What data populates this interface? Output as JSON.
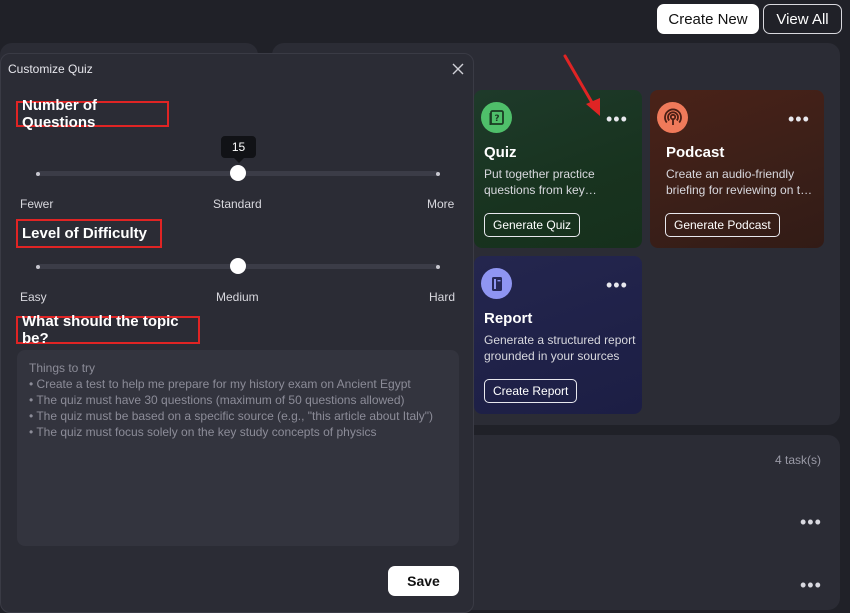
{
  "topbar": {
    "create_new": "Create New",
    "view_all": "View All"
  },
  "tasks": {
    "count_label": "4 task(s)"
  },
  "cards": [
    {
      "title": "Quiz",
      "desc": "Put together practice questions from key concepts",
      "button": "Generate Quiz",
      "icon": "quiz-icon",
      "accent": "#4fbf6a"
    },
    {
      "title": "Podcast",
      "desc": "Create an audio-friendly briefing for reviewing on the go",
      "button": "Generate Podcast",
      "icon": "podcast-icon",
      "accent": "#f07a5a"
    },
    {
      "title": "Report",
      "desc": "Generate a structured report grounded in your sources",
      "button": "Create Report",
      "icon": "report-icon",
      "accent": "#8f95f2"
    }
  ],
  "modal": {
    "title": "Customize Quiz",
    "num_questions": {
      "label": "Number of Questions",
      "value": 15,
      "min_label": "Fewer",
      "mid_label": "Standard",
      "max_label": "More",
      "position": 0.5
    },
    "difficulty": {
      "label": "Level of Difficulty",
      "min_label": "Easy",
      "mid_label": "Medium",
      "max_label": "Hard",
      "position": 0.5
    },
    "topic": {
      "label": "What should the topic be?",
      "placeholder_lines": [
        "Things to try",
        "• Create a test to help me prepare for my history exam on Ancient Egypt",
        "• The quiz must have 30 questions (maximum of 50 questions allowed)",
        "• The quiz must be based on a specific source (e.g., \"this article about Italy\")",
        "• The quiz must focus solely on the key study concepts of physics"
      ]
    },
    "save": "Save"
  }
}
